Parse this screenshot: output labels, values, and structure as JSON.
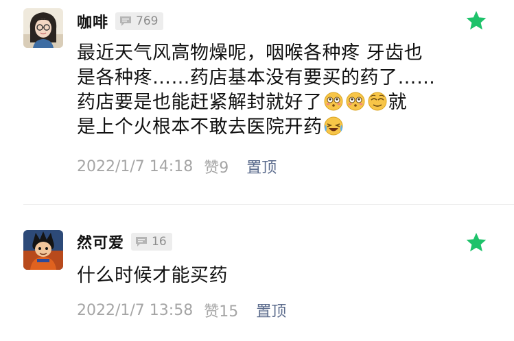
{
  "comments": [
    {
      "username": "咖啡",
      "reply_count": "769",
      "content_lines": [
        "最近天气风高物燥呢，咽喉各种疼 牙齿也",
        "是各种疼……药店基本没有要买的药了……",
        "药店要是也能赶紧解封就好了",
        "就",
        "是上个火根本不敢去医院开药"
      ],
      "timestamp": "2022/1/7 14:18",
      "likes": "赞9",
      "pin_label": "置顶"
    },
    {
      "username": "然可爱",
      "reply_count": "16",
      "content": "什么时候才能买药",
      "timestamp": "2022/1/7 13:58",
      "likes": "赞15",
      "pin_label": "置顶"
    }
  ],
  "icons": {
    "reply": "speech-bubble-icon",
    "featured": "star-icon",
    "emoji_1": "flushed-face-icon",
    "emoji_2": "relieved-face-icon",
    "emoji_3": "crying-laughing-face-icon"
  },
  "colors": {
    "star": "#1ec26a",
    "pin": "#5b6b8c",
    "meta": "#a5a5a5",
    "badge_bg": "#ededed"
  }
}
